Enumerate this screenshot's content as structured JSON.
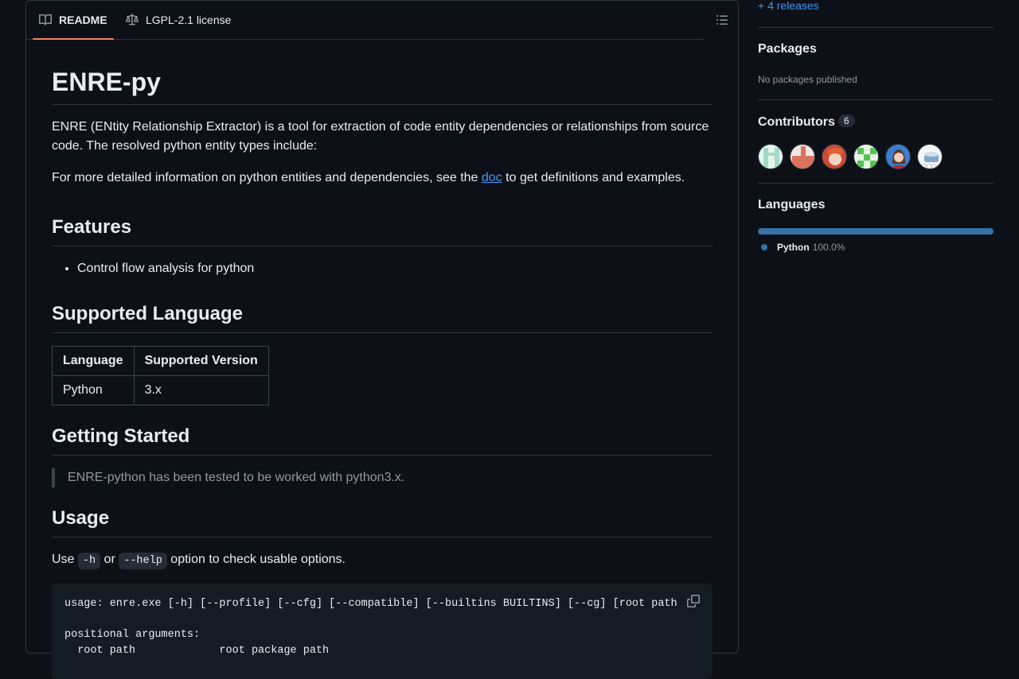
{
  "readme": {
    "tabs": [
      {
        "label": "README",
        "icon": "book-icon",
        "active": true
      },
      {
        "label": "LGPL-2.1 license",
        "icon": "law-icon",
        "active": false
      }
    ],
    "toc_icon": "list-unordered-icon",
    "title": "ENRE-py",
    "intro": "ENRE (ENtity Relationship Extractor) is a tool for extraction of code entity dependencies or relationships from source code. The resolved python entity types include:",
    "detail_prefix": "For more detailed information on python entities and dependencies, see the ",
    "detail_link": "doc",
    "detail_suffix": " to get definitions and examples.",
    "features_heading": "Features",
    "features": [
      "Control flow analysis for python"
    ],
    "supported_heading": "Supported Language",
    "table": {
      "headers": [
        "Language",
        "Supported Version"
      ],
      "rows": [
        [
          "Python",
          "3.x"
        ]
      ]
    },
    "getting_started_heading": "Getting Started",
    "quote": "ENRE-python has been tested to be worked with python3.x.",
    "usage_heading": "Usage",
    "usage_prefix": "Use ",
    "usage_code1": "-h",
    "usage_mid": " or ",
    "usage_code2": "--help",
    "usage_suffix": " option to check usable options.",
    "code_block": "usage: enre.exe [-h] [--profile] [--cfg] [--compatible] [--builtins BUILTINS] [--cg] [root path]\n\npositional arguments:\n  root path             root package path",
    "copy_icon": "copy-icon"
  },
  "sidebar": {
    "releases_link": "+ 4 releases",
    "packages_heading": "Packages",
    "packages_text": "No packages published",
    "contributors_heading": "Contributors",
    "contributors_count": "6",
    "contributors": [
      {
        "name": "contributor-1",
        "colors": [
          "#e8f2ee",
          "#9fdcc4"
        ]
      },
      {
        "name": "contributor-2",
        "colors": [
          "#f0e6e4",
          "#d9735e"
        ]
      },
      {
        "name": "contributor-3",
        "colors": [
          "#c94a3a",
          "#f4d3c0"
        ]
      },
      {
        "name": "contributor-4",
        "colors": [
          "#e8f5e6",
          "#55c455"
        ]
      },
      {
        "name": "contributor-5",
        "colors": [
          "#3a7fd0",
          "#5a3a2a"
        ]
      },
      {
        "name": "contributor-6",
        "colors": [
          "#f5f5f5",
          "#7fa8c8"
        ]
      }
    ],
    "languages_heading": "Languages",
    "languages": [
      {
        "name": "Python",
        "percent": "100.0%",
        "color": "#3572a5",
        "fraction": 1.0
      }
    ]
  }
}
